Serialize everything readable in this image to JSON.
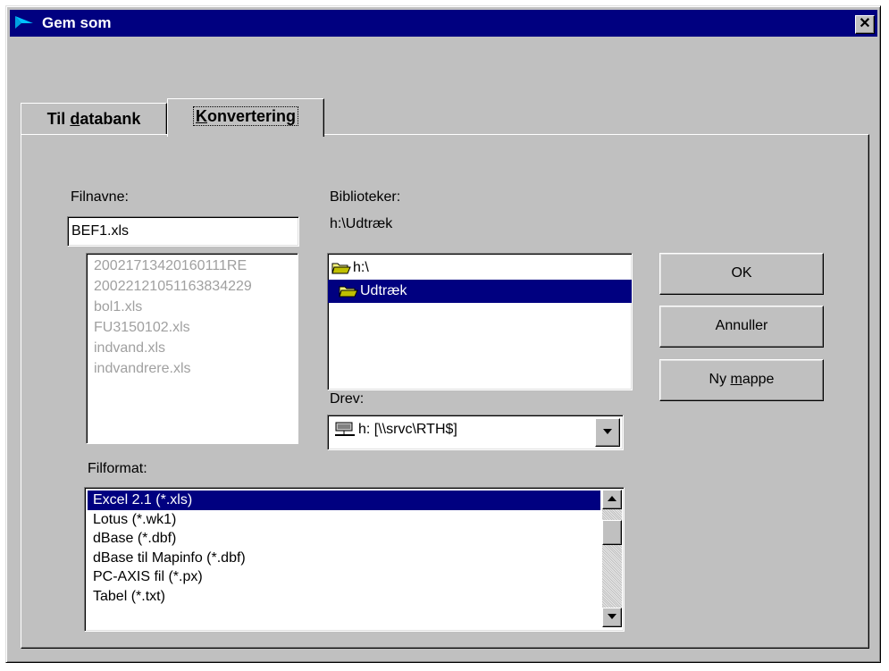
{
  "window": {
    "title": "Gem som",
    "close_label": "✕"
  },
  "tabs": [
    {
      "pre": "Til ",
      "underline": "d",
      "post": "atabank"
    },
    {
      "pre": "",
      "underline": "K",
      "post": "onvertering"
    }
  ],
  "filename": {
    "label": "Filnavne:",
    "value": "BEF1.xls"
  },
  "files": [
    "20021713420160111RE",
    "20022121051163834229",
    "bol1.xls",
    "FU3150102.xls",
    "indvand.xls",
    "indvandrere.xls"
  ],
  "directories": {
    "label": "Biblioteker:",
    "current_path": "h:\\Udtræk",
    "items": [
      "h:\\",
      "Udtræk"
    ],
    "selected": "Udtræk"
  },
  "drive": {
    "label": "Drev:",
    "value": "h: [\\\\srvc\\RTH$]"
  },
  "buttons": {
    "ok": "OK",
    "cancel": "Annuller",
    "new_folder_pre": "Ny ",
    "new_folder_underline": "m",
    "new_folder_post": "appe"
  },
  "format": {
    "label": "Filformat:",
    "items": [
      "Excel 2.1 (*.xls)",
      "Lotus (*.wk1)",
      "dBase (*.dbf)",
      "dBase til Mapinfo (*.dbf)",
      "PC-AXIS fil (*.px)",
      "Tabel (*.txt)"
    ],
    "selected": "Excel 2.1 (*.xls)"
  },
  "colors": {
    "title_bar": "#000080",
    "selection": "#000080",
    "face": "#c0c0c0"
  }
}
